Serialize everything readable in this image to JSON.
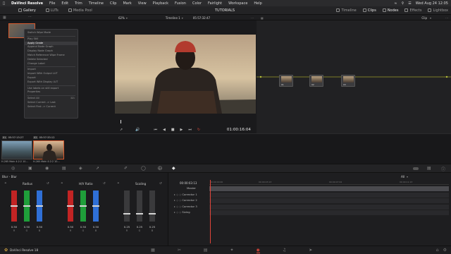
{
  "menubar": {
    "app_name": "DaVinci Resolve",
    "items": [
      "File",
      "Edit",
      "Trim",
      "Timeline",
      "Clip",
      "Mark",
      "View",
      "Playback",
      "Fusion",
      "Color",
      "Fairlight",
      "Workspace",
      "Help"
    ],
    "datetime": "Wed Aug 24  12:05"
  },
  "toolbar": {
    "gallery": "Gallery",
    "luts": "LUTs",
    "media_pool": "Media Pool",
    "project_title": "TUTORIALS",
    "timeline": "Timeline",
    "clips": "Clips",
    "nodes": "Nodes",
    "effects": "Effects",
    "lightbox": "Lightbox"
  },
  "viewer": {
    "zoom": "62%",
    "timeline_name": "Timeline 1",
    "timecode_top": "05:57:32:47",
    "timecode": "01:00:16:04"
  },
  "node_editor": {
    "clip_mode": "Clip",
    "nodes": [
      {
        "label": "01"
      },
      {
        "label": "02"
      },
      {
        "label": "03"
      }
    ]
  },
  "context_menu": {
    "items": [
      {
        "label": "Switch Wipe Mode",
        "style": "dim"
      },
      {
        "sep": true
      },
      {
        "label": "Play Still",
        "style": "dim"
      },
      {
        "label": "Apply Grade",
        "style": "hl"
      },
      {
        "label": "Append Node Graph",
        "style": "dim"
      },
      {
        "label": "Display Node Graph",
        "style": "dim"
      },
      {
        "label": "Match Reference Wipe Frame",
        "style": "dim"
      },
      {
        "label": "Delete Selected",
        "style": "dim"
      },
      {
        "label": "Change Label",
        "style": "dim"
      },
      {
        "sep": true
      },
      {
        "label": "Import",
        "style": "dim"
      },
      {
        "label": "Import With Output LUT",
        "style": "dim"
      },
      {
        "label": "Export",
        "style": "dim"
      },
      {
        "label": "Export With Display LUT",
        "style": "dim"
      },
      {
        "sep": true
      },
      {
        "label": "Use labels on still export",
        "style": "dim"
      },
      {
        "label": "Properties",
        "style": "dim"
      },
      {
        "sep": true
      },
      {
        "label": "Select All",
        "style": "dim",
        "shortcut": "⌘A"
      },
      {
        "label": "Select Current -> Last",
        "style": "dim"
      },
      {
        "label": "Select First -> Current",
        "style": "dim"
      }
    ]
  },
  "clips": [
    {
      "id": "01",
      "tc": "05:57:13:27",
      "name": "H.265 Main 4:2:2 10..."
    },
    {
      "id": "02",
      "tc": "05:57:33:12",
      "name": "H.265 Main 4:2:2 10..."
    }
  ],
  "primaries": {
    "panel_title": "Blur - Blur",
    "groups": [
      {
        "title": "Radius",
        "values": [
          "0.50",
          "0.50",
          "0.50"
        ],
        "channels": [
          "R",
          "G",
          "B"
        ],
        "levels": [
          0.5,
          0.5,
          0.5
        ]
      },
      {
        "title": "H/V Ratio",
        "values": [
          "0.50",
          "0.50",
          "0.50"
        ],
        "channels": [
          "R",
          "G",
          "B"
        ],
        "levels": [
          0.5,
          0.5,
          0.5
        ]
      },
      {
        "title": "Scaling",
        "values": [
          "0.25",
          "0.25",
          "0.25"
        ],
        "channels": [
          "R",
          "G",
          "B"
        ],
        "levels": [
          0.25,
          0.25,
          0.25
        ]
      }
    ],
    "colors": {
      "r": "#c22424",
      "g": "#1f9e3a",
      "b": "#2f6fd6"
    }
  },
  "keyframes": {
    "title": "Keyframes",
    "filter": "All",
    "timecode": "00:00:03:13",
    "ruler": [
      "00:00:00:00",
      "00:00:03:13",
      "00:00:07:02",
      "00:00:11:13"
    ],
    "rows": [
      "Master",
      "Corrector 1",
      "Corrector 2",
      "Corrector 3",
      "Sizing"
    ]
  },
  "pagebar": {
    "product": "DaVinci Resolve 18"
  }
}
